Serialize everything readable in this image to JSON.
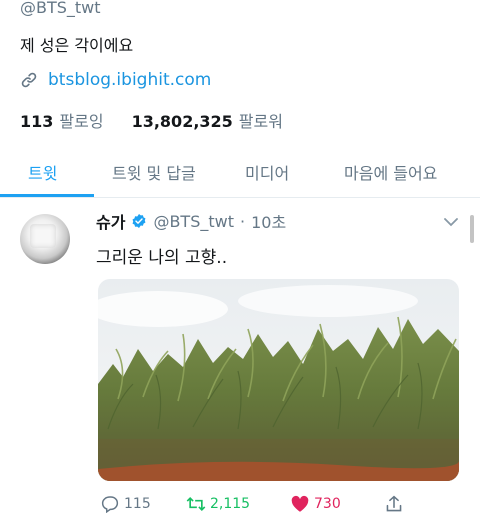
{
  "profile": {
    "handle": "@BTS_twt",
    "bio": "제 성은 각이에요",
    "link": "btsblog.ibighit.com",
    "following_count": "113",
    "following_label": "팔로잉",
    "followers_count": "13,802,325",
    "followers_label": "팔로워"
  },
  "tabs": [
    {
      "label": "트윗",
      "active": true
    },
    {
      "label": "트윗 및 답글",
      "active": false
    },
    {
      "label": "미디어",
      "active": false
    },
    {
      "label": "마음에 들어요",
      "active": false
    }
  ],
  "tweet": {
    "display_name": "슈가",
    "handle": "@BTS_twt",
    "separator": "·",
    "time": "10초",
    "text": "그리운 나의 고향..",
    "actions": {
      "reply_count": "115",
      "retweet_count": "2,115",
      "like_count": "730"
    }
  },
  "colors": {
    "accent": "#1da1f2",
    "link": "#1b95e0",
    "retweet": "#17bf63",
    "like": "#e0245e",
    "muted": "#657786"
  },
  "icons": [
    "link-icon",
    "verified-badge-icon",
    "chevron-down-icon",
    "reply-icon",
    "retweet-icon",
    "heart-icon",
    "share-icon"
  ]
}
